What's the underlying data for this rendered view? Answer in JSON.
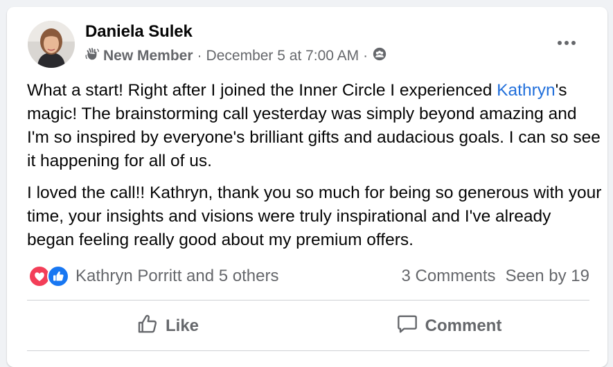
{
  "post": {
    "author": "Daniela Sulek",
    "badge_icon": "hand-wave-icon",
    "member_label": "New Member",
    "separator": "·",
    "timestamp": "December 5 at 7:00 AM",
    "audience_icon": "group-audience-icon",
    "more_icon": "more-options-icon",
    "paragraph1": {
      "before": "What a start! Right after I joined the Inner Circle I experienced ",
      "mention": "Kathryn",
      "after": "'s magic! The brainstorming call yesterday was simply beyond amazing and I'm so inspired by everyone's brilliant gifts and audacious goals. I can so see it happening for all of us."
    },
    "paragraph2": "I loved the call!! Kathryn, thank you so much for being so generous with your time, your insights and visions were truly inspirational and I've already began feeling really good about my premium offers."
  },
  "reactions": {
    "icons": [
      "love-reaction-icon",
      "like-reaction-icon"
    ],
    "names": "Kathryn Porritt and 5 others",
    "comments": "3 Comments",
    "seen": "Seen by 19"
  },
  "actions": {
    "like_label": "Like",
    "comment_label": "Comment"
  },
  "colors": {
    "mention": "#216fdb",
    "love": "#f33e58",
    "like": "#1877f2",
    "secondary_text": "#65676b"
  }
}
